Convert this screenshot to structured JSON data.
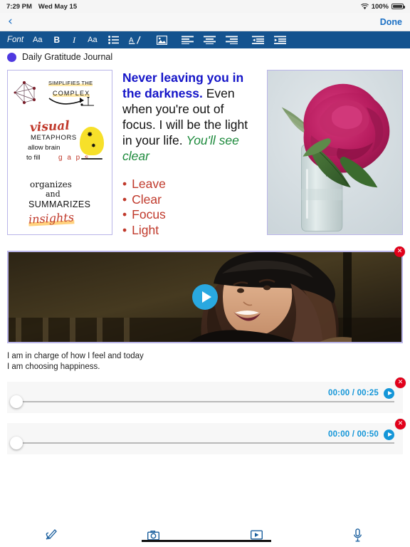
{
  "status_bar": {
    "time": "7:29 PM",
    "date": "Wed May 15",
    "battery_percent": "100%",
    "wifi_icon": "wifi-icon",
    "battery_icon": "battery-icon"
  },
  "nav_bar": {
    "back_icon": "chevron-left-icon",
    "back_label": "‹",
    "done_label": "Done"
  },
  "format_toolbar": {
    "items": [
      {
        "label": "Font",
        "name": "font-picker",
        "icon": ""
      },
      {
        "label": "Aa",
        "name": "font-size",
        "icon": ""
      },
      {
        "label": "B",
        "name": "bold",
        "icon": ""
      },
      {
        "label": "I",
        "name": "italic",
        "icon": ""
      },
      {
        "label": "Aa",
        "name": "text-style",
        "icon": ""
      },
      {
        "label": "",
        "name": "bullet-list",
        "icon": "list-icon"
      },
      {
        "label": "A/",
        "name": "text-color",
        "icon": "text-color-icon"
      },
      {
        "label": "",
        "name": "insert-image",
        "icon": "image-icon"
      },
      {
        "label": "",
        "name": "align-left",
        "icon": "align-left-icon"
      },
      {
        "label": "",
        "name": "align-center",
        "icon": "align-center-icon"
      },
      {
        "label": "",
        "name": "align-right",
        "icon": "align-right-icon"
      },
      {
        "label": "",
        "name": "outdent",
        "icon": "outdent-icon"
      },
      {
        "label": "",
        "name": "indent",
        "icon": "indent-icon"
      }
    ],
    "background_color": "#14538f"
  },
  "document": {
    "bullet_color": "#4f39e0",
    "title": "Daily Gratitude Journal",
    "sketch_image": {
      "alt": "visual-metaphors-sketchnote",
      "lines": {
        "simplifies": "SIMPLIFIES THE",
        "complex": "COMPLEX",
        "visual": "visual",
        "metaphors": "METAPHORS",
        "allow_brain": "allow brain",
        "to_fill": "to fill",
        "gaps": "g a p s",
        "organizes": "organizes",
        "and": "and",
        "summarizes": "SUMMARIZES",
        "insights": "insights"
      }
    },
    "paragraph": {
      "blue_bold": "Never leaving you in the darkness.",
      "black": " Even when you're out of focus. I will be the light in your life. ",
      "green_italic": "You'll see clear"
    },
    "bullet_list": [
      "Leave",
      "Clear",
      "Focus",
      "Light"
    ],
    "flower_image": {
      "alt": "pink-peony-in-glass-vase"
    },
    "video": {
      "alt": "smiling-woman-video-thumbnail",
      "play_icon": "play-icon",
      "close_icon": "close-icon"
    },
    "caption_line1": "I am in charge of how I feel and today",
    "caption_line2": "I am choosing happiness.",
    "audio_players": [
      {
        "time": "00:00 / 00:25",
        "play_icon": "play-icon",
        "close_icon": "close-icon",
        "progress": 0
      },
      {
        "time": "00:00 / 00:50",
        "play_icon": "play-icon",
        "close_icon": "close-icon",
        "progress": 0
      }
    ],
    "accent_blue": "#1496d8",
    "delete_red": "#e2001a"
  },
  "bottom_toolbar": {
    "items": [
      {
        "name": "draw-icon",
        "label": ""
      },
      {
        "name": "camera-icon",
        "label": ""
      },
      {
        "name": "video-icon",
        "label": ""
      },
      {
        "name": "microphone-icon",
        "label": ""
      }
    ]
  }
}
